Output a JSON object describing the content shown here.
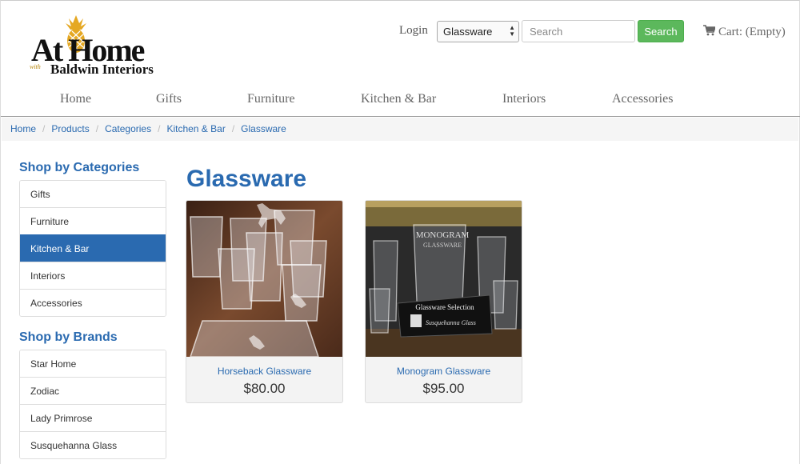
{
  "logo": {
    "title": "At Home",
    "with": "with",
    "subtitle": "Baldwin Interiors"
  },
  "header": {
    "login": "Login",
    "category_select": "Glassware",
    "search_placeholder": "Search",
    "search_button": "Search",
    "cart": "Cart: (Empty)"
  },
  "nav": [
    "Home",
    "Gifts",
    "Furniture",
    "Kitchen & Bar",
    "Interiors",
    "Accessories"
  ],
  "breadcrumb": [
    "Home",
    "Products",
    "Categories",
    "Kitchen & Bar",
    "Glassware"
  ],
  "sidebar": {
    "categories_heading": "Shop by Categories",
    "categories": [
      "Gifts",
      "Furniture",
      "Kitchen & Bar",
      "Interiors",
      "Accessories"
    ],
    "active_category": "Kitchen & Bar",
    "brands_heading": "Shop by Brands",
    "brands": [
      "Star Home",
      "Zodiac",
      "Lady Primrose",
      "Susquehanna Glass"
    ]
  },
  "main": {
    "title": "Glassware",
    "products": [
      {
        "name": "Horseback Glassware",
        "price": "$80.00"
      },
      {
        "name": "Monogram Glassware",
        "price": "$95.00"
      }
    ]
  },
  "product_images": {
    "p2_sign_top": "MONOGRAM",
    "p2_sign_bottom": "GLASSWARE",
    "p2_card_title": "Glassware Selection",
    "p2_card_brand": "Susquehanna Glass"
  },
  "colors": {
    "accent": "#2a6ab0",
    "search_button": "#5cb85c",
    "logo_gold": "#e5a823"
  }
}
